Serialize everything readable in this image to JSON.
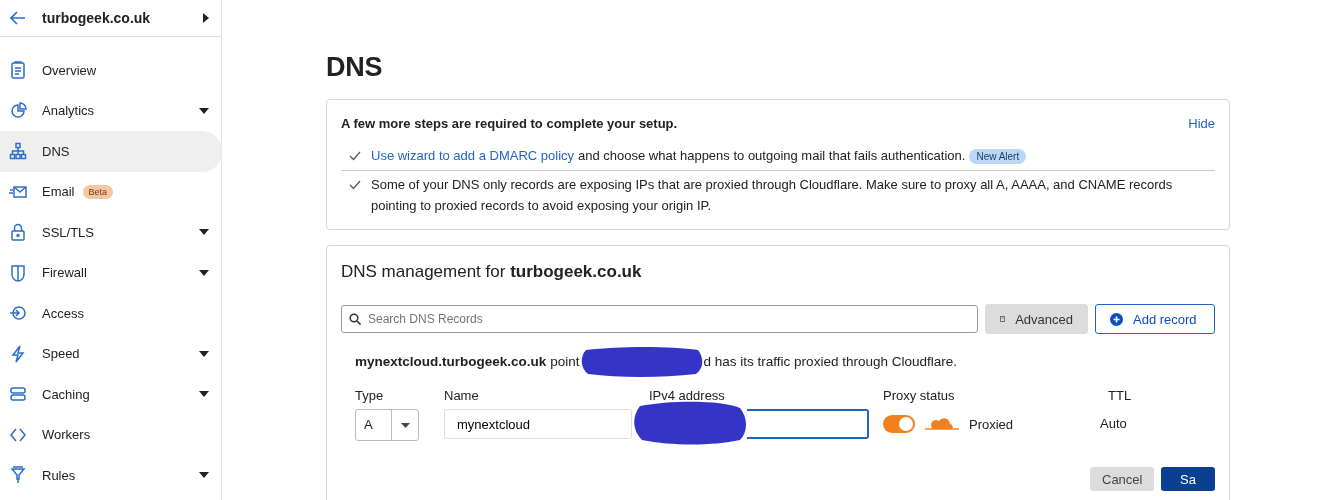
{
  "sidebar": {
    "title": "turbogeek.co.uk",
    "items": [
      {
        "label": "Overview",
        "selected": false,
        "expandable": false
      },
      {
        "label": "Analytics",
        "selected": false,
        "expandable": true
      },
      {
        "label": "DNS",
        "selected": true,
        "expandable": false
      },
      {
        "label": "Email",
        "selected": false,
        "expandable": false,
        "badge": "Beta"
      },
      {
        "label": "SSL/TLS",
        "selected": false,
        "expandable": true
      },
      {
        "label": "Firewall",
        "selected": false,
        "expandable": true
      },
      {
        "label": "Access",
        "selected": false,
        "expandable": false
      },
      {
        "label": "Speed",
        "selected": false,
        "expandable": true
      },
      {
        "label": "Caching",
        "selected": false,
        "expandable": true
      },
      {
        "label": "Workers",
        "selected": false,
        "expandable": false
      },
      {
        "label": "Rules",
        "selected": false,
        "expandable": true
      }
    ]
  },
  "page_title": "DNS",
  "setup_card": {
    "title": "A few more steps are required to complete your setup.",
    "hide_link": "Hide",
    "steps": [
      {
        "link": "Use wizard to add a DMARC policy",
        "text": "and choose what happens to outgoing mail that fails authentication.",
        "badge": "New Alert"
      },
      {
        "text": "Some of your DNS only records are exposing IPs that are proxied through Cloudflare. Make sure to proxy all A, AAAA, and CNAME records pointing to proxied records to avoid exposing your origin IP."
      }
    ]
  },
  "dns_card": {
    "heading": "DNS management for **turbogeek.co.uk**",
    "search": {
      "placeholder": "Search DNS Records"
    },
    "advanced_button": "Advanced",
    "add_button": "Add record",
    "record_note": {
      "name": "mynextcloud.turbogeek.co.uk",
      "before": "point",
      "after": "d has its traffic proxied through Cloudflare."
    },
    "form": {
      "type_label": "Type",
      "type_value": "A",
      "name_label": "Name",
      "name_value": "mynextcloud",
      "address_label": "IPv4 address",
      "proxy_label": "Proxy status",
      "proxy_on": true,
      "proxy_text": "Proxied",
      "ttl_label": "TTL",
      "ttl_value": "Auto"
    },
    "buttons": [
      {
        "label": "Cancel",
        "kind": "secondary"
      },
      {
        "label": "Sa",
        "kind": "primary"
      }
    ]
  }
}
